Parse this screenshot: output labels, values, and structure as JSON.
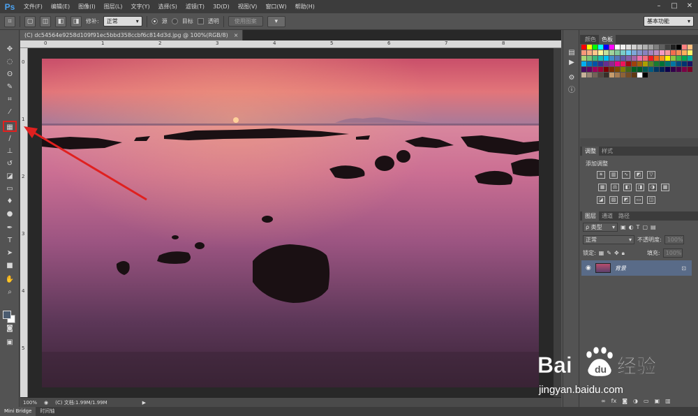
{
  "app": {
    "logo": "Ps"
  },
  "menu": [
    "文件(F)",
    "编辑(E)",
    "图像(I)",
    "图层(L)",
    "文字(Y)",
    "选择(S)",
    "滤镜(T)",
    "3D(D)",
    "视图(V)",
    "窗口(W)",
    "帮助(H)"
  ],
  "options": {
    "repair_label": "修补:",
    "mode_value": "正常",
    "source_label": "源",
    "target_label": "目标",
    "transparent_label": "透明",
    "use_pattern_label": "使用图案",
    "workspace_value": "基本功能"
  },
  "document": {
    "tab_title": "(C) dc54564e9258d109f91ec5bbd358ccbf6c814d3d.jpg @ 100%(RGB/8)",
    "tab_close": "×",
    "ruler_top": [
      "0",
      "1",
      "2",
      "3",
      "4",
      "5",
      "6",
      "7",
      "8"
    ],
    "ruler_left": [
      "0",
      "1",
      "2",
      "3",
      "4",
      "5"
    ]
  },
  "status": {
    "zoom": "100%",
    "doc_info": "(C) 文档:1.99M/1.99M"
  },
  "bottom_tabs": [
    "Mini Bridge",
    "时间轴"
  ],
  "panels": {
    "color_tabs": [
      "颜色",
      "色板"
    ],
    "adjust_tabs": [
      "调整",
      "样式"
    ],
    "adjust_title": "添加调整",
    "layers_tabs": [
      "图层",
      "通道",
      "路径"
    ],
    "layer_filter": "ρ 类型",
    "blend_mode": "正常",
    "opacity_label": "不透明度:",
    "opacity_value": "100%",
    "lock_label": "锁定:",
    "fill_label": "填充:",
    "fill_value": "100%",
    "layer_name": "背景"
  },
  "watermark": {
    "text": "jingyan.baidu.com"
  },
  "colors": {
    "menubar": "#3c3c3c",
    "panel": "#535353",
    "layer_selected": "#596b88",
    "highlight": "#e0201f"
  }
}
